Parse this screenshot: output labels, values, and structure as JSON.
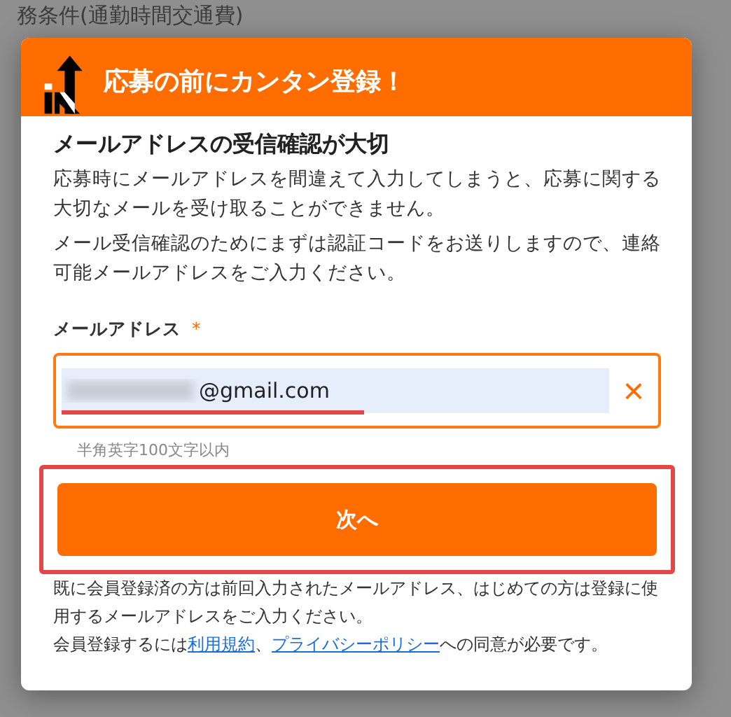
{
  "background_page": {
    "fragments": [
      "務条件(通勤時間交通費)"
    ]
  },
  "dialog": {
    "title": "応募の前にカンタン登録！",
    "heading": "メールアドレスの受信確認が大切",
    "paragraphs": [
      "応募時にメールアドレスを間違えて入力してしまうと、応募に関する大切なメールを受け取ることができません。",
      "メール受信確認のためにまずは認証コードをお送りしますので、連絡可能メールアドレスをご入力ください。"
    ],
    "email_field": {
      "label": "メールアドレス",
      "required_mark": "*",
      "value": "@gmail.com",
      "clear_icon": "×",
      "hint": "半角英字100文字以内"
    },
    "next_button": "次へ",
    "notes": [
      "既に会員登録済の方は前回入力されたメールアドレス、はじめての方は登録に使用するメールアドレスをご入力ください。"
    ],
    "consent": {
      "before": "会員登録するには",
      "terms_link": "利用規約",
      "separator": "、",
      "privacy_link": "プライバシーポリシー",
      "after": "への同意が必要です。"
    }
  }
}
